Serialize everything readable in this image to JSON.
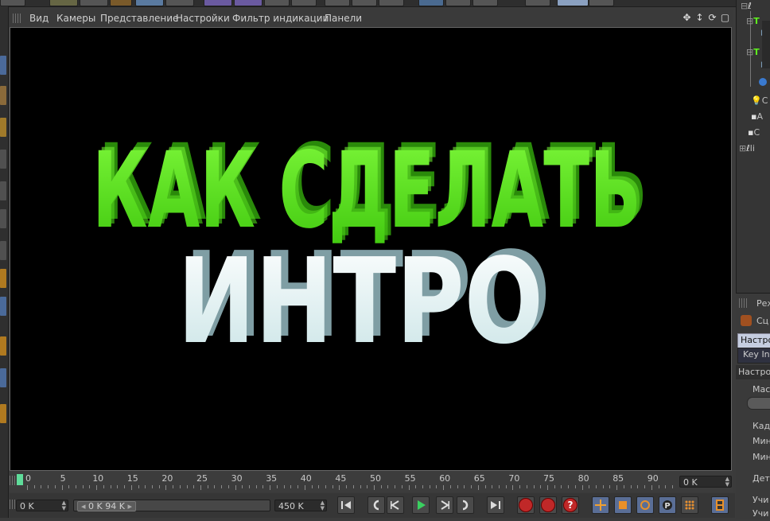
{
  "viewport": {
    "menu": [
      "Вид",
      "Камеры",
      "Представление",
      "Настройки",
      "Фильтр индикации",
      "Панели"
    ],
    "title_line1": "КАК СДЕЛАТЬ",
    "title_line2": "ИНТРО",
    "colors": {
      "line1": "#5ef11e",
      "line2": "#e8f4f4",
      "background": "#000000"
    }
  },
  "object_manager": {
    "items": [
      {
        "label": "ℓ",
        "icon": "null-icon"
      },
      {
        "label": "T",
        "icon": "text-icon"
      },
      {
        "label": "T",
        "icon": "text-icon"
      },
      {
        "label": "С",
        "icon": "light-icon"
      },
      {
        "label": "А",
        "icon": "camera-icon"
      },
      {
        "label": "С",
        "icon": "camera-icon"
      },
      {
        "label": "li",
        "icon": "null-icon"
      }
    ]
  },
  "attributes": {
    "header": "Реж",
    "scene_label": "Сц",
    "tab_settings": "Настро",
    "tab_key": "Key Int",
    "section": "Настро",
    "row_mas": "Мас",
    "row_kad": "Кадр",
    "row_min1": "Мин",
    "row_min2": "Мин",
    "row_det": "Дета",
    "row_uch1": "Учи",
    "row_uch2": "Учи"
  },
  "timeline": {
    "ticks": [
      "0",
      "5",
      "10",
      "15",
      "20",
      "25",
      "30",
      "35",
      "40",
      "45",
      "50",
      "55",
      "60",
      "65",
      "70",
      "75",
      "80",
      "85",
      "90"
    ],
    "end_field": "0 K"
  },
  "controls": {
    "current_frame": "0 K",
    "range_start": "0 K",
    "range_end": "94 K",
    "max_frame": "450 K"
  }
}
